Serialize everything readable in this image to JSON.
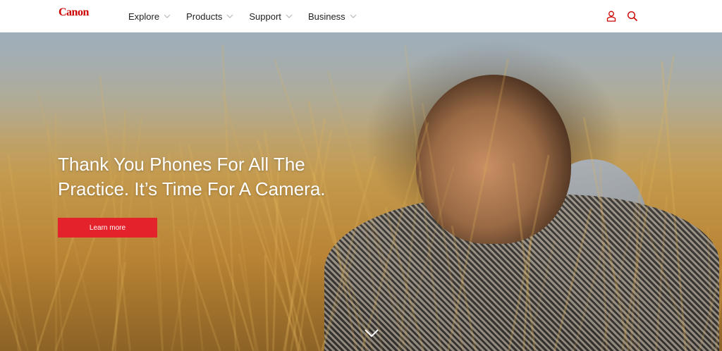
{
  "header": {
    "logo": "Canon",
    "nav": [
      {
        "label": "Explore"
      },
      {
        "label": "Products"
      },
      {
        "label": "Support"
      },
      {
        "label": "Business"
      }
    ],
    "icons": [
      "user-icon",
      "search-icon"
    ]
  },
  "hero": {
    "headline": "Thank You Phones For All The Practice. It’s Time For A Camera.",
    "cta_label": "Learn more",
    "scroll_icon": "chevron-down-icon"
  },
  "colors": {
    "brand": "#cc0000",
    "cta": "#e3222b",
    "nav_text": "#222222"
  }
}
